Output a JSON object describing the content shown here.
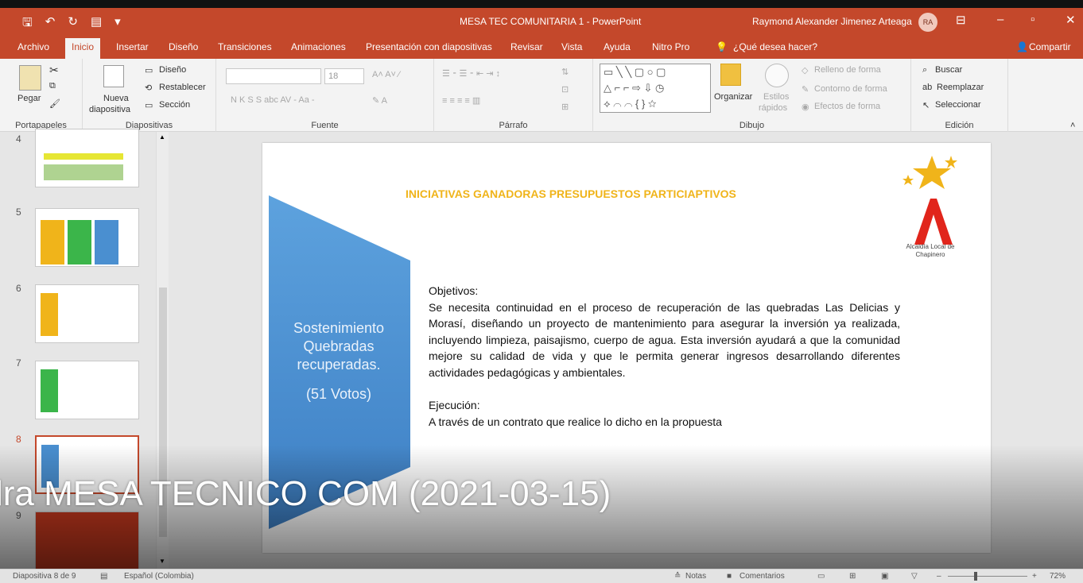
{
  "window": {
    "title": "MESA TEC COMUNITARIA 1 - PowerPoint",
    "user": "Raymond Alexander Jimenez Arteaga",
    "avatar": "RA"
  },
  "menu": {
    "tabs": [
      "Archivo",
      "Inicio",
      "Insertar",
      "Diseño",
      "Transiciones",
      "Animaciones",
      "Presentación con diapositivas",
      "Revisar",
      "Vista",
      "Ayuda",
      "Nitro Pro"
    ],
    "tell_me": "¿Qué desea hacer?",
    "share": "Compartir"
  },
  "ribbon": {
    "clipboard": {
      "paste": "Pegar",
      "label": "Portapapeles"
    },
    "slides": {
      "new_slide_1": "Nueva",
      "new_slide_2": "diapositiva",
      "layout": "Diseño",
      "reset": "Restablecer",
      "section": "Sección",
      "label": "Diapositivas"
    },
    "font": {
      "size": "18",
      "label": "Fuente",
      "format_buttons": "N K S S abc AV - Aa -"
    },
    "paragraph": {
      "label": "Párrafo"
    },
    "drawing": {
      "arrange": "Organizar",
      "styles_1": "Estilos",
      "styles_2": "rápidos",
      "fill": "Relleno de forma",
      "outline": "Contorno de forma",
      "effects": "Efectos de forma",
      "label": "Dibujo"
    },
    "editing": {
      "find": "Buscar",
      "replace": "Reemplazar",
      "select": "Seleccionar",
      "label": "Edición"
    }
  },
  "thumbnails": [
    "4",
    "5",
    "6",
    "7",
    "8",
    "9"
  ],
  "slide": {
    "heading": "INICIATIVAS GANADORAS PRESUPUESTOS PARTICIAPTIVOS",
    "shape_line1": "Sostenimiento",
    "shape_line2": "Quebradas",
    "shape_line3": "recuperadas.",
    "votes": "(51 Votos)",
    "objectives_label": "Objetivos:",
    "objectives_text": "Se necesita continuidad en el proceso de recuperación de las quebradas Las Delicias y Morasí, diseñando un proyecto  de mantenimiento para asegurar la inversión ya realizada, incluyendo limpieza, paisajismo, cuerpo de agua. Esta inversión ayudará a que la comunidad mejore su calidad  de vida y que le permita generar ingresos desarrollando diferentes actividades pedagógicas y ambientales.",
    "execution_label": "Ejecución:",
    "execution_text": "A través de un contrato que realice lo dicho en la propuesta",
    "logo_line1": "Alcaldía Local de",
    "logo_line2": "Chapinero"
  },
  "caption": "lra MESA TECNICO COM (2021-03-15)",
  "status": {
    "slide_pos": "Diapositiva 8 de 9",
    "language": "Español (Colombia)",
    "notes": "Notas",
    "comments": "Comentarios",
    "zoom": "72%"
  },
  "colors": {
    "accent": "#c4482b",
    "heading": "#f0b41a",
    "shape_blue": "#4a8fd0"
  }
}
